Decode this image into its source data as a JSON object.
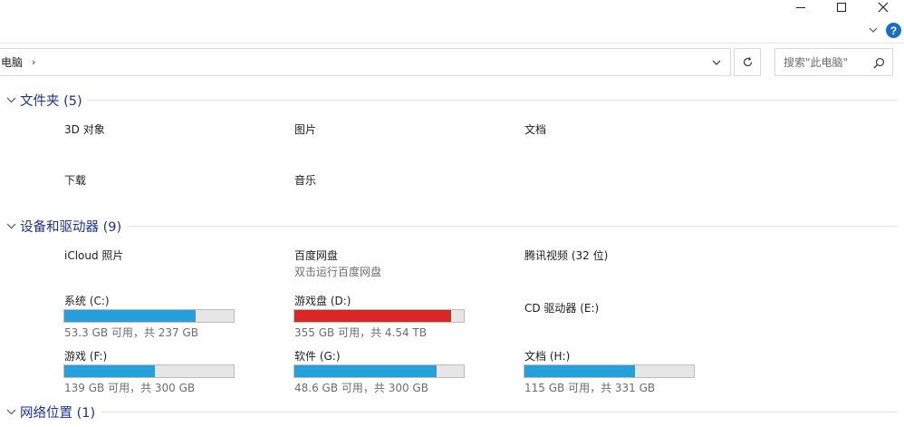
{
  "window": {
    "controls": {
      "minimize": "minimize",
      "maximize": "maximize",
      "close": "close"
    }
  },
  "address": {
    "path": "电脑",
    "separator": "›"
  },
  "search": {
    "placeholder": "搜索\"此电脑\""
  },
  "groups": {
    "folders": {
      "title": "文件夹 (5)",
      "items": [
        {
          "label": "3D 对象"
        },
        {
          "label": "图片"
        },
        {
          "label": "文档"
        },
        {
          "label": "下载"
        },
        {
          "label": "音乐"
        }
      ]
    },
    "devices": {
      "title": "设备和驱动器 (9)",
      "items": [
        {
          "label": "iCloud 照片"
        },
        {
          "label": "百度网盘",
          "sub": "双击运行百度网盘"
        },
        {
          "label": "腾讯视频 (32 位)"
        }
      ],
      "drives": [
        {
          "label": "系统 (C:)",
          "usage": "53.3 GB 可用，共 237 GB",
          "used_fraction": 0.775,
          "color": "#26a0da"
        },
        {
          "label": "游戏盘 (D:)",
          "usage": "355 GB 可用，共 4.54 TB",
          "used_fraction": 0.924,
          "color": "#da2626"
        },
        {
          "label": "CD 驱动器 (E:)"
        },
        {
          "label": "游戏 (F:)",
          "usage": "139 GB 可用，共 300 GB",
          "used_fraction": 0.537,
          "color": "#26a0da"
        },
        {
          "label": "软件 (G:)",
          "usage": "48.6 GB 可用，共 300 GB",
          "used_fraction": 0.838,
          "color": "#26a0da"
        },
        {
          "label": "文档 (H:)",
          "usage": "115 GB 可用，共 331 GB",
          "used_fraction": 0.653,
          "color": "#26a0da"
        }
      ]
    },
    "network": {
      "title": "网络位置 (1)"
    }
  },
  "colors": {
    "group_title": "#1e3287",
    "bar_normal": "#26a0da",
    "bar_full": "#da2626",
    "help_blue": "#1a6fc2"
  },
  "icons": [
    "minimize-icon",
    "maximize-icon",
    "close-icon",
    "chevron-down-icon",
    "help-icon",
    "refresh-icon",
    "search-icon"
  ]
}
